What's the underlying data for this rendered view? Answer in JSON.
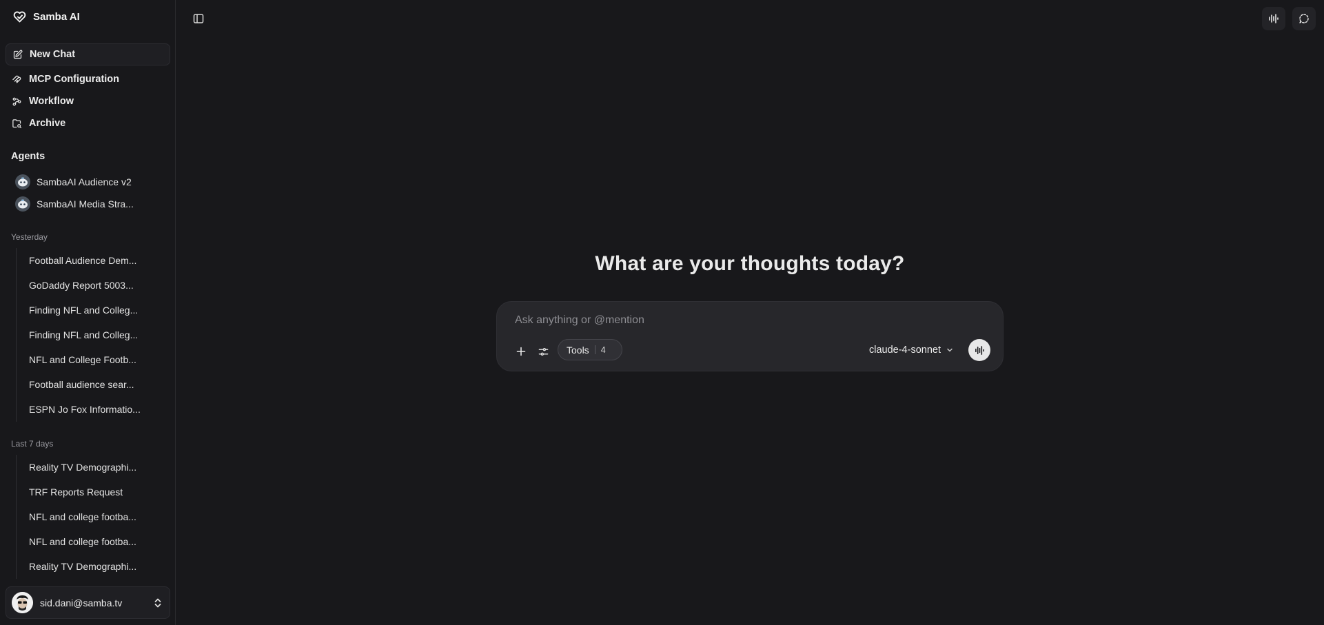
{
  "brand": {
    "name": "Samba AI"
  },
  "nav": [
    {
      "label": "New Chat",
      "icon": "edit-icon"
    },
    {
      "label": "MCP Configuration",
      "icon": "mcp-icon"
    },
    {
      "label": "Workflow",
      "icon": "workflow-icon"
    },
    {
      "label": "Archive",
      "icon": "archive-icon"
    }
  ],
  "agents": {
    "title": "Agents",
    "items": [
      {
        "name": "SambaAI Audience v2"
      },
      {
        "name": "SambaAI Media Stra..."
      }
    ]
  },
  "history": {
    "yesterday_label": "Yesterday",
    "yesterday": [
      "Football Audience Dem...",
      "GoDaddy Report 5003...",
      "Finding NFL and Colleg...",
      "Finding NFL and Colleg...",
      "NFL and College Footb...",
      "Football audience sear...",
      "ESPN Jo Fox Informatio..."
    ],
    "last7_label": "Last 7 days",
    "last7": [
      "Reality TV Demographi...",
      "TRF Reports Request",
      "NFL and college footba...",
      "NFL and college footba...",
      "Reality TV Demographi..."
    ]
  },
  "user": {
    "email": "sid.dani@samba.tv"
  },
  "main": {
    "heading": "What are your thoughts today?",
    "composer": {
      "placeholder": "Ask anything or @mention",
      "tools_label": "Tools",
      "tools_count": "4",
      "model": "claude-4-sonnet"
    }
  },
  "colors": {
    "background": "#18181b",
    "composer": "#27272b",
    "text": "#ececec",
    "muted": "#9a9aa0"
  }
}
